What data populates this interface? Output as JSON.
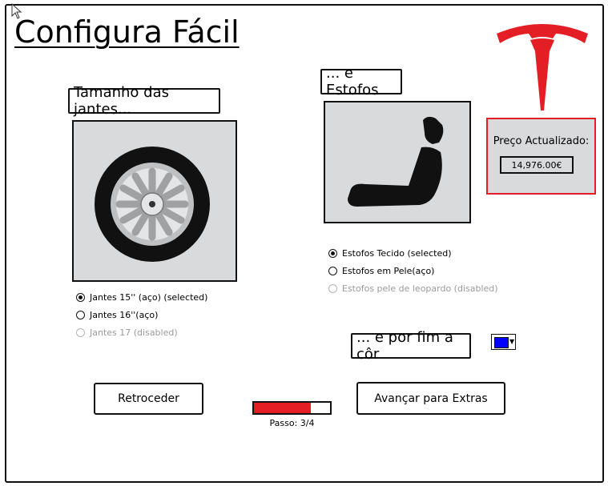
{
  "title": "Configura Fácil",
  "logo_icon": "tesla-logo-icon",
  "jantes": {
    "label": "Tamanho das jantes...",
    "image_icon": "wheel-icon",
    "options": [
      {
        "label": "Jantes 15'' (aço) (selected)",
        "selected": true,
        "disabled": false
      },
      {
        "label": "Jantes 16''(aço)",
        "selected": false,
        "disabled": false
      },
      {
        "label": "Jantes 17 (disabled)",
        "selected": false,
        "disabled": true
      }
    ]
  },
  "estofos": {
    "label": "... e Estofos",
    "image_icon": "seat-icon",
    "options": [
      {
        "label": "Estofos Tecido (selected)",
        "selected": true,
        "disabled": false
      },
      {
        "label": "Estofos em Pele(aço)",
        "selected": false,
        "disabled": false
      },
      {
        "label": "Estofos pele de leopardo (disabled)",
        "selected": false,
        "disabled": true
      }
    ]
  },
  "price": {
    "label": "Preço Actualizado:",
    "value": "14,976.00€"
  },
  "cor": {
    "label": "... e por fim a côr",
    "selected_color": "#0000ff"
  },
  "buttons": {
    "back": "Retroceder",
    "next": "Avançar para Extras"
  },
  "progress": {
    "fraction": 0.75,
    "label": "Passo: 3/4"
  },
  "colors": {
    "accent": "#e31e24",
    "panel": "#d9dadb"
  }
}
